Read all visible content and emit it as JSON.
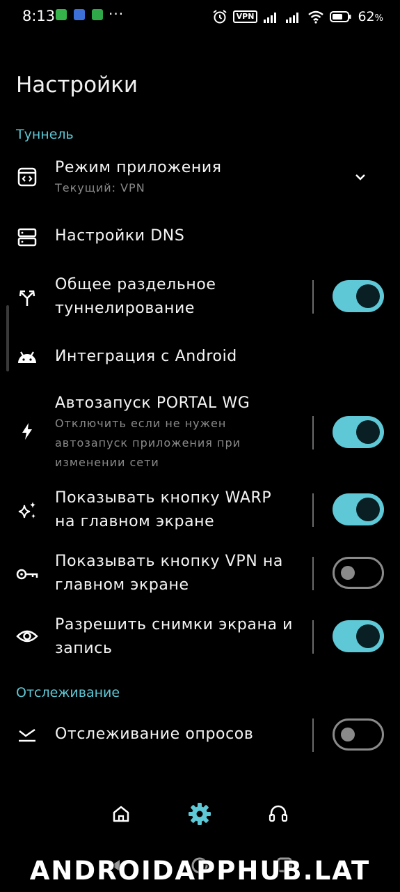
{
  "status_bar": {
    "time": "8:13",
    "dots": "···",
    "vpn_badge": "VPN",
    "battery_percent": "62",
    "battery_percent_sign": "%"
  },
  "page_title": "Настройки",
  "sections": {
    "tunnel": "Туннель",
    "tracking": "Отслеживание"
  },
  "settings": {
    "app_mode": {
      "title": "Режим приложения",
      "subtitle": "Текущий: VPN",
      "icon": "app-window-code-icon"
    },
    "dns": {
      "title": "Настройки DNS",
      "icon": "dns-server-icon"
    },
    "split_tunnel": {
      "title_line1": "Общее раздельное",
      "title_line2": "туннелирование",
      "icon": "split-arrows-icon",
      "enabled": true
    },
    "android_integration": {
      "title": "Интеграция с Android",
      "icon": "android-icon"
    },
    "autostart": {
      "title": "Автозапуск PORTAL WG",
      "subtitle_line1": "Отключить если не нужен",
      "subtitle_line2": "автозапуск приложения при",
      "subtitle_line3": "изменении сети",
      "icon": "bolt-icon",
      "enabled": true
    },
    "warp_button": {
      "title_line1": "Показывать кнопку WARP",
      "title_line2": "на главном экране",
      "icon": "sparkles-icon",
      "enabled": true
    },
    "vpn_button": {
      "title_line1": "Показывать кнопку VPN на",
      "title_line2": "главном экране",
      "icon": "key-icon",
      "enabled": false
    },
    "screenshots": {
      "title_line1": "Разрешить снимки экрана и",
      "title_line2": "запись",
      "icon": "eye-icon",
      "enabled": true
    },
    "polls_tracking": {
      "title": "Отслеживание опросов",
      "icon": "poll-tracking-icon",
      "enabled": false
    }
  },
  "bottom_nav": {
    "active": "settings",
    "items": [
      "home-icon",
      "settings-gear-icon",
      "support-headset-icon"
    ]
  },
  "watermark": "ANDROIDAPPHUB.LAT",
  "colors": {
    "accent": "#5ec8d6",
    "background": "#000000",
    "text": "#f5f5f5",
    "secondary_text": "#8a8a8a"
  }
}
